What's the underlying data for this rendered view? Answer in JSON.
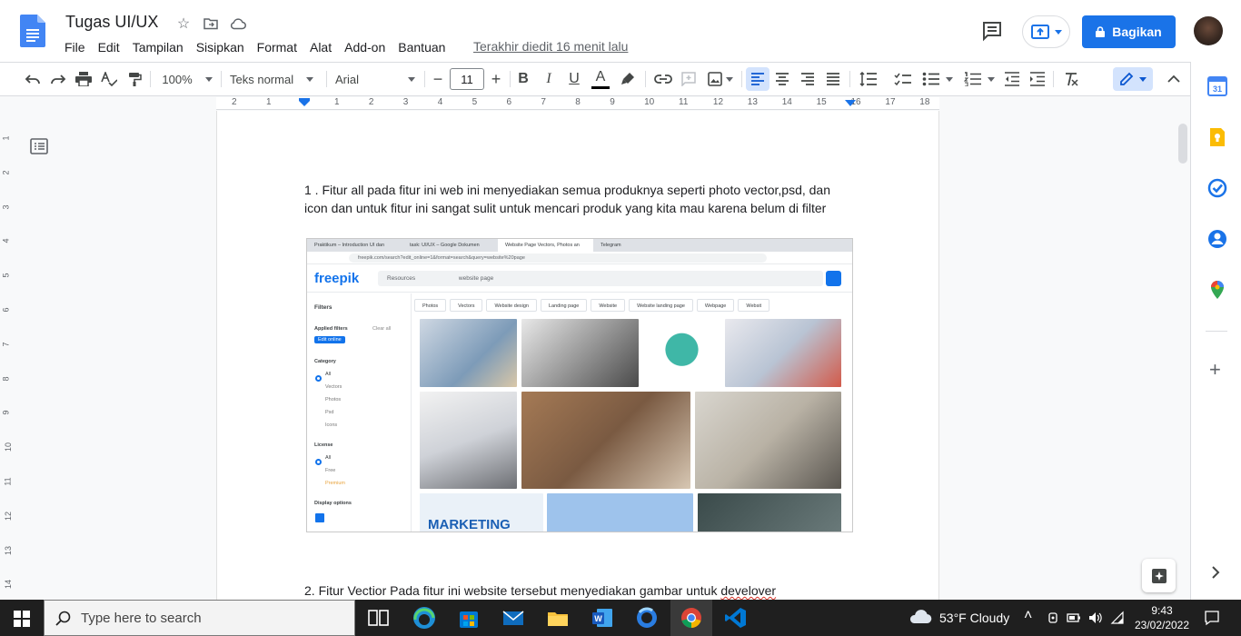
{
  "header": {
    "doc_title": "Tugas UI/UX",
    "last_edit": "Terakhir diedit 16 menit lalu",
    "share_label": "Bagikan",
    "menu": [
      "File",
      "Edit",
      "Tampilan",
      "Sisipkan",
      "Format",
      "Alat",
      "Add-on",
      "Bantuan"
    ]
  },
  "toolbar": {
    "zoom": "100%",
    "style": "Teks normal",
    "font": "Arial",
    "font_size": "11"
  },
  "ruler": {
    "marks": [
      "2",
      "1",
      "1",
      "2",
      "3",
      "4",
      "5",
      "6",
      "7",
      "8",
      "9",
      "10",
      "11",
      "12",
      "13",
      "14",
      "15",
      "16",
      "17",
      "18"
    ],
    "vmarks": [
      "1",
      "2",
      "3",
      "4",
      "5",
      "6",
      "7",
      "8",
      "9",
      "10",
      "11",
      "12",
      "13",
      "14"
    ]
  },
  "document": {
    "p1": "1 . Fitur all pada fitur ini web ini menyediakan semua produknya seperti photo vector,psd, dan icon dan untuk fitur ini sangat sulit untuk mencari produk yang kita mau karena belum di filter",
    "p2_start": "2. Fitur Vectior Pada fitur ini website tersebut menyediakan gambar untuk ",
    "p2_misspelled": "develover"
  },
  "embedded_screenshot": {
    "tabs": [
      "Praktikum – Introduction UI dan",
      "task: UI/UX – Google Dokumen",
      "Website Page Vectors, Photos an",
      "Telegram"
    ],
    "url": "freepik.com/search?edit_online=1&format=search&query=website%20page",
    "logo": "freepik",
    "search_category": "Resources",
    "search_value": "website page",
    "filters_title": "Filters",
    "applied_filters": "Applied filters",
    "clear_all": "Clear all",
    "applied_chip": "Edit online",
    "category_title": "Category",
    "categories": [
      "All",
      "Vectors",
      "Photos",
      "Psd",
      "Icons"
    ],
    "license_title": "License",
    "licenses": [
      "All",
      "Free",
      "Premium"
    ],
    "display_title": "Display options",
    "chips": [
      "Photos",
      "Vectors",
      "Website design",
      "Landing page",
      "Website",
      "Website landing page",
      "Webpage",
      "Websit"
    ],
    "marketing_text": "MARKETING"
  },
  "taskbar": {
    "search_placeholder": "Type here to search",
    "weather": "53°F  Cloudy",
    "time": "9:43",
    "date": "23/02/2022"
  },
  "colors": {
    "accent": "#1a73e8",
    "docs_blue": "#4285f4",
    "taskbar": "#1f1f1f"
  }
}
